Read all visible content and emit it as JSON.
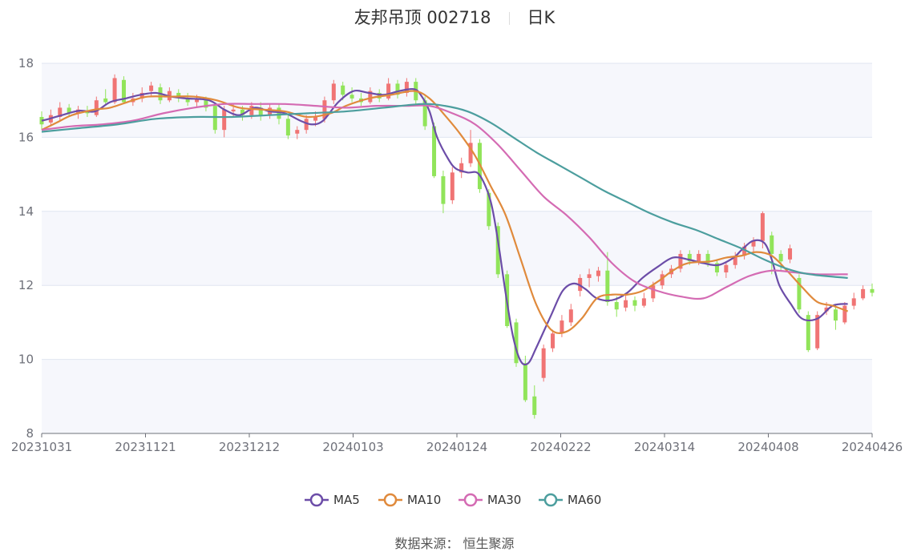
{
  "header": {
    "title": "友邦吊顶 002718",
    "period": "日K"
  },
  "source_text": "数据来源：  恒生聚源",
  "chart_data": {
    "type": "candlestick",
    "ylim": [
      8,
      18
    ],
    "y_ticks": [
      8,
      10,
      12,
      14,
      16,
      18
    ],
    "x_ticks": [
      "20231031",
      "20231121",
      "20231212",
      "20240103",
      "20240124",
      "20240222",
      "20240314",
      "20240408",
      "20240426"
    ],
    "up_color": "#f07474",
    "down_color": "#91e45a",
    "series": [
      {
        "name": "MA5",
        "color": "#6c4da8",
        "points": [
          [
            0,
            16.45
          ],
          [
            0.01,
            16.5
          ],
          [
            0.03,
            16.62
          ],
          [
            0.05,
            16.72
          ],
          [
            0.07,
            16.7
          ],
          [
            0.09,
            16.95
          ],
          [
            0.11,
            17.05
          ],
          [
            0.13,
            17.15
          ],
          [
            0.15,
            17.2
          ],
          [
            0.17,
            17.1
          ],
          [
            0.19,
            17.05
          ],
          [
            0.22,
            17.0
          ],
          [
            0.24,
            16.75
          ],
          [
            0.26,
            16.6
          ],
          [
            0.28,
            16.8
          ],
          [
            0.3,
            16.7
          ],
          [
            0.32,
            16.65
          ],
          [
            0.34,
            16.45
          ],
          [
            0.355,
            16.35
          ],
          [
            0.37,
            16.45
          ],
          [
            0.39,
            16.95
          ],
          [
            0.41,
            17.25
          ],
          [
            0.43,
            17.2
          ],
          [
            0.45,
            17.15
          ],
          [
            0.47,
            17.25
          ],
          [
            0.49,
            17.3
          ],
          [
            0.5,
            17.1
          ],
          [
            0.51,
            16.7
          ],
          [
            0.52,
            16.0
          ],
          [
            0.535,
            15.4
          ],
          [
            0.545,
            15.15
          ],
          [
            0.56,
            15.05
          ],
          [
            0.575,
            15.0
          ],
          [
            0.59,
            14.3
          ],
          [
            0.6,
            13.2
          ],
          [
            0.61,
            11.8
          ],
          [
            0.62,
            10.6
          ],
          [
            0.63,
            9.95
          ],
          [
            0.64,
            9.9
          ],
          [
            0.65,
            10.3
          ],
          [
            0.67,
            11.2
          ],
          [
            0.685,
            11.85
          ],
          [
            0.7,
            12.05
          ],
          [
            0.715,
            11.9
          ],
          [
            0.73,
            11.65
          ],
          [
            0.75,
            11.6
          ],
          [
            0.77,
            11.8
          ],
          [
            0.79,
            12.2
          ],
          [
            0.81,
            12.5
          ],
          [
            0.83,
            12.75
          ],
          [
            0.85,
            12.7
          ],
          [
            0.87,
            12.6
          ],
          [
            0.89,
            12.55
          ],
          [
            0.91,
            12.75
          ],
          [
            0.92,
            12.95
          ],
          [
            0.935,
            13.2
          ],
          [
            0.95,
            13.15
          ],
          [
            0.96,
            12.7
          ],
          [
            0.97,
            12.0
          ],
          [
            0.985,
            11.5
          ],
          [
            1.0,
            11.1
          ],
          [
            1.02,
            11.1
          ],
          [
            1.04,
            11.45
          ],
          [
            1.06,
            11.5
          ]
        ]
      },
      {
        "name": "MA10",
        "color": "#e08a3c",
        "points": [
          [
            0,
            16.2
          ],
          [
            0.02,
            16.4
          ],
          [
            0.04,
            16.6
          ],
          [
            0.07,
            16.75
          ],
          [
            0.09,
            16.8
          ],
          [
            0.12,
            17.0
          ],
          [
            0.14,
            17.1
          ],
          [
            0.17,
            17.1
          ],
          [
            0.2,
            17.1
          ],
          [
            0.23,
            17.0
          ],
          [
            0.26,
            16.8
          ],
          [
            0.29,
            16.75
          ],
          [
            0.32,
            16.7
          ],
          [
            0.35,
            16.55
          ],
          [
            0.38,
            16.65
          ],
          [
            0.4,
            16.85
          ],
          [
            0.43,
            17.05
          ],
          [
            0.46,
            17.15
          ],
          [
            0.49,
            17.25
          ],
          [
            0.51,
            17.05
          ],
          [
            0.53,
            16.6
          ],
          [
            0.55,
            16.1
          ],
          [
            0.57,
            15.5
          ],
          [
            0.59,
            14.7
          ],
          [
            0.61,
            13.9
          ],
          [
            0.63,
            12.7
          ],
          [
            0.65,
            11.5
          ],
          [
            0.67,
            10.8
          ],
          [
            0.69,
            10.75
          ],
          [
            0.71,
            11.1
          ],
          [
            0.73,
            11.65
          ],
          [
            0.75,
            11.75
          ],
          [
            0.77,
            11.75
          ],
          [
            0.79,
            11.85
          ],
          [
            0.81,
            12.1
          ],
          [
            0.83,
            12.4
          ],
          [
            0.85,
            12.6
          ],
          [
            0.88,
            12.65
          ],
          [
            0.9,
            12.75
          ],
          [
            0.92,
            12.8
          ],
          [
            0.94,
            12.9
          ],
          [
            0.96,
            12.8
          ],
          [
            0.98,
            12.4
          ],
          [
            1.0,
            11.95
          ],
          [
            1.02,
            11.55
          ],
          [
            1.04,
            11.45
          ],
          [
            1.06,
            11.3
          ]
        ]
      },
      {
        "name": "MA30",
        "color": "#d46bb3",
        "points": [
          [
            0,
            16.2
          ],
          [
            0.04,
            16.3
          ],
          [
            0.08,
            16.35
          ],
          [
            0.12,
            16.45
          ],
          [
            0.16,
            16.65
          ],
          [
            0.2,
            16.8
          ],
          [
            0.24,
            16.9
          ],
          [
            0.28,
            16.9
          ],
          [
            0.32,
            16.9
          ],
          [
            0.36,
            16.85
          ],
          [
            0.4,
            16.8
          ],
          [
            0.44,
            16.85
          ],
          [
            0.48,
            16.85
          ],
          [
            0.51,
            16.85
          ],
          [
            0.54,
            16.65
          ],
          [
            0.57,
            16.35
          ],
          [
            0.6,
            15.8
          ],
          [
            0.63,
            15.1
          ],
          [
            0.66,
            14.4
          ],
          [
            0.69,
            13.9
          ],
          [
            0.72,
            13.3
          ],
          [
            0.75,
            12.6
          ],
          [
            0.78,
            12.1
          ],
          [
            0.81,
            11.85
          ],
          [
            0.84,
            11.7
          ],
          [
            0.87,
            11.65
          ],
          [
            0.9,
            11.95
          ],
          [
            0.93,
            12.25
          ],
          [
            0.96,
            12.4
          ],
          [
            0.99,
            12.35
          ],
          [
            1.02,
            12.3
          ],
          [
            1.06,
            12.3
          ]
        ]
      },
      {
        "name": "MA60",
        "color": "#4c9e9e",
        "points": [
          [
            0,
            16.15
          ],
          [
            0.05,
            16.25
          ],
          [
            0.1,
            16.35
          ],
          [
            0.15,
            16.5
          ],
          [
            0.2,
            16.55
          ],
          [
            0.25,
            16.55
          ],
          [
            0.3,
            16.6
          ],
          [
            0.35,
            16.65
          ],
          [
            0.4,
            16.7
          ],
          [
            0.45,
            16.8
          ],
          [
            0.5,
            16.9
          ],
          [
            0.53,
            16.85
          ],
          [
            0.56,
            16.7
          ],
          [
            0.59,
            16.4
          ],
          [
            0.62,
            16.0
          ],
          [
            0.65,
            15.6
          ],
          [
            0.68,
            15.25
          ],
          [
            0.71,
            14.9
          ],
          [
            0.74,
            14.55
          ],
          [
            0.77,
            14.25
          ],
          [
            0.8,
            13.95
          ],
          [
            0.83,
            13.7
          ],
          [
            0.86,
            13.5
          ],
          [
            0.89,
            13.25
          ],
          [
            0.92,
            13.0
          ],
          [
            0.95,
            12.7
          ],
          [
            0.98,
            12.45
          ],
          [
            1.01,
            12.3
          ],
          [
            1.06,
            12.2
          ]
        ]
      }
    ],
    "candles": [
      [
        0.0,
        16.55,
        16.35,
        16.7,
        16.2
      ],
      [
        0.012,
        16.4,
        16.6,
        16.75,
        16.3
      ],
      [
        0.024,
        16.55,
        16.8,
        16.95,
        16.45
      ],
      [
        0.036,
        16.8,
        16.65,
        16.9,
        16.55
      ],
      [
        0.048,
        16.65,
        16.75,
        16.85,
        16.5
      ],
      [
        0.06,
        16.7,
        16.65,
        16.85,
        16.55
      ],
      [
        0.072,
        16.6,
        17.0,
        17.1,
        16.55
      ],
      [
        0.084,
        17.05,
        16.95,
        17.3,
        16.9
      ],
      [
        0.096,
        16.95,
        17.6,
        17.7,
        16.9
      ],
      [
        0.108,
        17.55,
        16.95,
        17.65,
        16.9
      ],
      [
        0.12,
        16.95,
        17.05,
        17.2,
        16.85
      ],
      [
        0.132,
        17.05,
        17.2,
        17.35,
        16.95
      ],
      [
        0.144,
        17.25,
        17.4,
        17.5,
        17.1
      ],
      [
        0.156,
        17.35,
        17.0,
        17.45,
        16.9
      ],
      [
        0.168,
        17.0,
        17.25,
        17.35,
        16.95
      ],
      [
        0.18,
        17.2,
        17.1,
        17.3,
        16.95
      ],
      [
        0.192,
        17.05,
        16.95,
        17.2,
        16.85
      ],
      [
        0.204,
        16.95,
        17.05,
        17.15,
        16.8
      ],
      [
        0.216,
        17.0,
        16.8,
        17.1,
        16.7
      ],
      [
        0.228,
        16.85,
        16.2,
        16.9,
        16.1
      ],
      [
        0.24,
        16.2,
        16.75,
        16.85,
        16.0
      ],
      [
        0.252,
        16.7,
        16.75,
        16.9,
        16.55
      ],
      [
        0.264,
        16.75,
        16.6,
        16.85,
        16.45
      ],
      [
        0.276,
        16.6,
        16.85,
        16.95,
        16.5
      ],
      [
        0.288,
        16.8,
        16.6,
        16.95,
        16.45
      ],
      [
        0.3,
        16.6,
        16.8,
        16.9,
        16.5
      ],
      [
        0.312,
        16.8,
        16.5,
        16.9,
        16.35
      ],
      [
        0.324,
        16.5,
        16.05,
        16.6,
        15.95
      ],
      [
        0.336,
        16.1,
        16.2,
        16.3,
        15.95
      ],
      [
        0.348,
        16.2,
        16.5,
        16.6,
        16.1
      ],
      [
        0.36,
        16.45,
        16.55,
        16.7,
        16.3
      ],
      [
        0.372,
        16.5,
        17.0,
        17.1,
        16.4
      ],
      [
        0.384,
        17.0,
        17.45,
        17.55,
        16.9
      ],
      [
        0.396,
        17.4,
        17.15,
        17.5,
        17.0
      ],
      [
        0.408,
        17.15,
        17.05,
        17.35,
        16.95
      ],
      [
        0.42,
        17.05,
        16.95,
        17.2,
        16.85
      ],
      [
        0.432,
        16.95,
        17.25,
        17.35,
        16.9
      ],
      [
        0.444,
        17.2,
        17.05,
        17.3,
        16.95
      ],
      [
        0.456,
        17.05,
        17.45,
        17.6,
        17.0
      ],
      [
        0.468,
        17.45,
        17.15,
        17.55,
        17.05
      ],
      [
        0.48,
        17.2,
        17.5,
        17.6,
        17.1
      ],
      [
        0.492,
        17.5,
        17.0,
        17.6,
        16.9
      ],
      [
        0.504,
        17.0,
        16.3,
        17.1,
        16.2
      ],
      [
        0.516,
        16.3,
        14.95,
        16.4,
        14.9
      ],
      [
        0.528,
        14.95,
        14.2,
        15.1,
        13.95
      ],
      [
        0.54,
        14.3,
        15.05,
        15.2,
        14.2
      ],
      [
        0.552,
        15.05,
        15.3,
        15.45,
        14.9
      ],
      [
        0.564,
        15.3,
        15.85,
        16.2,
        15.2
      ],
      [
        0.576,
        15.85,
        14.6,
        15.95,
        14.5
      ],
      [
        0.588,
        14.5,
        13.6,
        14.6,
        13.5
      ],
      [
        0.6,
        13.6,
        12.3,
        13.7,
        12.2
      ],
      [
        0.612,
        12.3,
        10.9,
        12.4,
        10.85
      ],
      [
        0.624,
        11.0,
        9.9,
        11.1,
        9.8
      ],
      [
        0.636,
        9.9,
        8.9,
        10.1,
        8.85
      ],
      [
        0.648,
        9.0,
        8.5,
        9.3,
        8.4
      ],
      [
        0.66,
        9.5,
        10.3,
        10.4,
        9.4
      ],
      [
        0.672,
        10.3,
        10.7,
        10.8,
        10.2
      ],
      [
        0.684,
        10.7,
        11.05,
        11.2,
        10.6
      ],
      [
        0.696,
        11.0,
        11.35,
        11.5,
        10.9
      ],
      [
        0.708,
        11.85,
        12.2,
        12.3,
        11.7
      ],
      [
        0.72,
        12.2,
        12.3,
        12.45,
        11.95
      ],
      [
        0.732,
        12.25,
        12.4,
        12.5,
        12.1
      ],
      [
        0.744,
        12.4,
        11.55,
        12.9,
        11.45
      ],
      [
        0.756,
        11.55,
        11.35,
        11.7,
        11.15
      ],
      [
        0.768,
        11.4,
        11.6,
        11.75,
        11.3
      ],
      [
        0.78,
        11.6,
        11.45,
        11.7,
        11.3
      ],
      [
        0.792,
        11.45,
        11.65,
        11.8,
        11.4
      ],
      [
        0.804,
        11.65,
        12.0,
        12.1,
        11.55
      ],
      [
        0.816,
        12.0,
        12.3,
        12.4,
        11.9
      ],
      [
        0.828,
        12.3,
        12.45,
        12.55,
        12.2
      ],
      [
        0.84,
        12.45,
        12.85,
        12.95,
        12.35
      ],
      [
        0.852,
        12.85,
        12.65,
        12.95,
        12.55
      ],
      [
        0.864,
        12.65,
        12.85,
        12.95,
        12.55
      ],
      [
        0.876,
        12.85,
        12.6,
        12.95,
        12.5
      ],
      [
        0.888,
        12.6,
        12.35,
        12.7,
        12.25
      ],
      [
        0.9,
        12.35,
        12.55,
        12.65,
        12.2
      ],
      [
        0.912,
        12.55,
        12.8,
        12.9,
        12.45
      ],
      [
        0.924,
        12.8,
        13.05,
        13.15,
        12.7
      ],
      [
        0.936,
        13.05,
        13.2,
        13.3,
        12.9
      ],
      [
        0.948,
        13.2,
        13.95,
        14.0,
        13.0
      ],
      [
        0.96,
        13.35,
        12.85,
        13.45,
        12.3
      ],
      [
        0.972,
        12.85,
        12.65,
        12.95,
        12.4
      ],
      [
        0.984,
        12.7,
        13.0,
        13.1,
        12.6
      ],
      [
        0.996,
        12.2,
        11.35,
        12.3,
        11.25
      ],
      [
        1.008,
        11.2,
        10.25,
        11.3,
        10.2
      ],
      [
        1.02,
        10.3,
        11.2,
        11.3,
        10.25
      ],
      [
        1.032,
        11.3,
        11.4,
        11.55,
        11.2
      ],
      [
        1.044,
        11.35,
        11.05,
        11.5,
        10.8
      ],
      [
        1.056,
        11.0,
        11.45,
        11.55,
        10.95
      ],
      [
        1.068,
        11.45,
        11.65,
        11.8,
        11.35
      ],
      [
        1.08,
        11.65,
        11.9,
        12.0,
        11.6
      ],
      [
        1.092,
        11.9,
        11.8,
        12.05,
        11.7
      ]
    ]
  }
}
